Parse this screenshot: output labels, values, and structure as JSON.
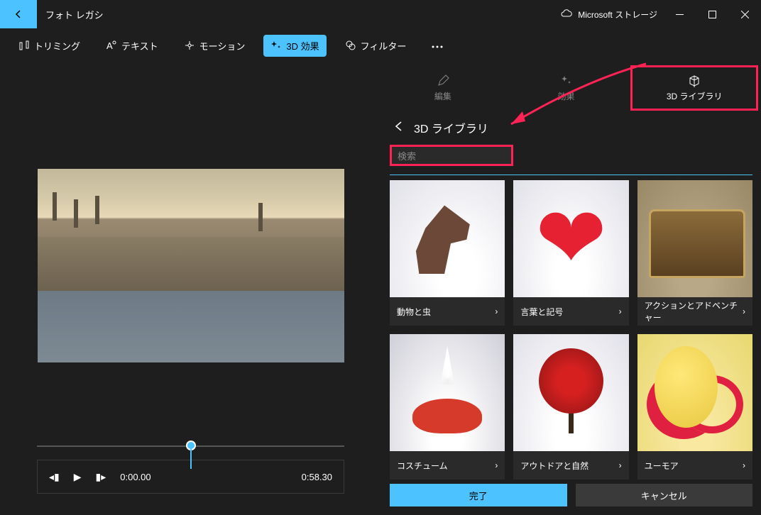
{
  "titlebar": {
    "app_name": "フォト レガシ",
    "storage_label": "Microsoft ストレージ"
  },
  "toolbar": {
    "trim": "トリミング",
    "text": "テキスト",
    "motion": "モーション",
    "effects_3d": "3D 効果",
    "filter": "フィルター"
  },
  "playback": {
    "current_time": "0:00.00",
    "total_time": "0:58.30"
  },
  "panel": {
    "tabs": {
      "edit": "編集",
      "effects": "効果",
      "library_3d": "3D ライブラリ"
    },
    "header_title": "3D ライブラリ",
    "search_placeholder": "検索",
    "categories": [
      {
        "label": "動物と虫",
        "thumb": "dino"
      },
      {
        "label": "言葉と記号",
        "thumb": "heart"
      },
      {
        "label": "アクションとアドベンチャー",
        "thumb": "chest"
      },
      {
        "label": "コスチューム",
        "thumb": "costume"
      },
      {
        "label": "アウトドアと自然",
        "thumb": "tree"
      },
      {
        "label": "ユーモア",
        "thumb": "humor"
      }
    ],
    "done_label": "完了",
    "cancel_label": "キャンセル"
  }
}
